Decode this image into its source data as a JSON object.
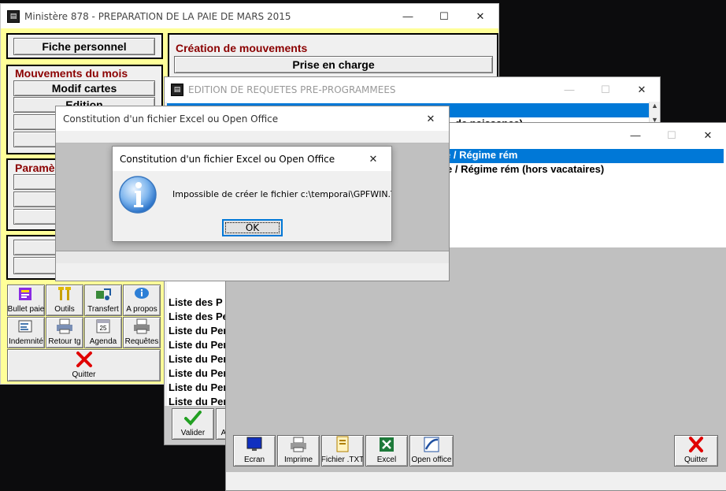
{
  "main_window": {
    "title": "Ministère 878 - PREPARATION DE LA PAIE DE MARS 2015",
    "controls": {
      "minimize": "—",
      "maximize": "☐",
      "close": "✕"
    },
    "fiche_button": "Fiche personnel",
    "mouvements": {
      "title": "Mouvements du mois",
      "buttons": [
        "Modif cartes",
        "Edition",
        "D",
        "C"
      ]
    },
    "parametres": {
      "title": "Paramè",
      "buttons": [
        "C",
        "",
        "I"
      ]
    },
    "sys_group": {
      "buttons": [
        "",
        "Sy"
      ]
    },
    "creation": {
      "title": "Création de mouvements",
      "buttons": [
        "Prise en charge"
      ]
    },
    "toolbar": [
      {
        "label": "Bullet paie",
        "icon": "payslip-icon"
      },
      {
        "label": "Outils",
        "icon": "tools-icon"
      },
      {
        "label": "Transfert",
        "icon": "transfer-icon"
      },
      {
        "label": "A propos",
        "icon": "info-icon"
      },
      {
        "label": "Indemnité",
        "icon": "indemnity-icon"
      },
      {
        "label": "Retour tg",
        "icon": "printer-icon"
      },
      {
        "label": "Agenda",
        "icon": "calendar-icon"
      },
      {
        "label": "Requêtes",
        "icon": "query-printer-icon"
      }
    ],
    "quit_label": "Quitter",
    "calendar_day": "25"
  },
  "requetes_window": {
    "title": "EDITION DE REQUETES PRE-PROGRAMMEES",
    "partial_row_2": "de naissance)",
    "rows": [
      "Liste des P",
      "Liste des Pe",
      "Liste du Per",
      "Liste du Per",
      "Liste du Per",
      "Liste du Per",
      "Liste du Per",
      "Liste du Per",
      "Liste du Per"
    ],
    "valider_label": "Valider",
    "partial_button_label": "A"
  },
  "export_window": {
    "rows": [
      "e / Régime rém",
      "e / Régime rém (hors vacataires)"
    ],
    "buttons": [
      "Ecran",
      "Imprime",
      "Fichier .TXT",
      "Excel",
      "Open office"
    ],
    "quit_label": "Quitter"
  },
  "constitution_window": {
    "title": "Constitution d'un fichier Excel ou Open Office"
  },
  "message_box": {
    "title": "Constitution d'un fichier Excel ou Open Office",
    "message": "Impossible de créer le fichier c:\\temporai\\GPFWIN.TXT",
    "ok_label": "OK",
    "icon": "info-icon"
  },
  "colors": {
    "main_background": "#ffff99",
    "group_title": "#8b0000",
    "selection": "#0078d7",
    "quit_x": "#e00000"
  }
}
